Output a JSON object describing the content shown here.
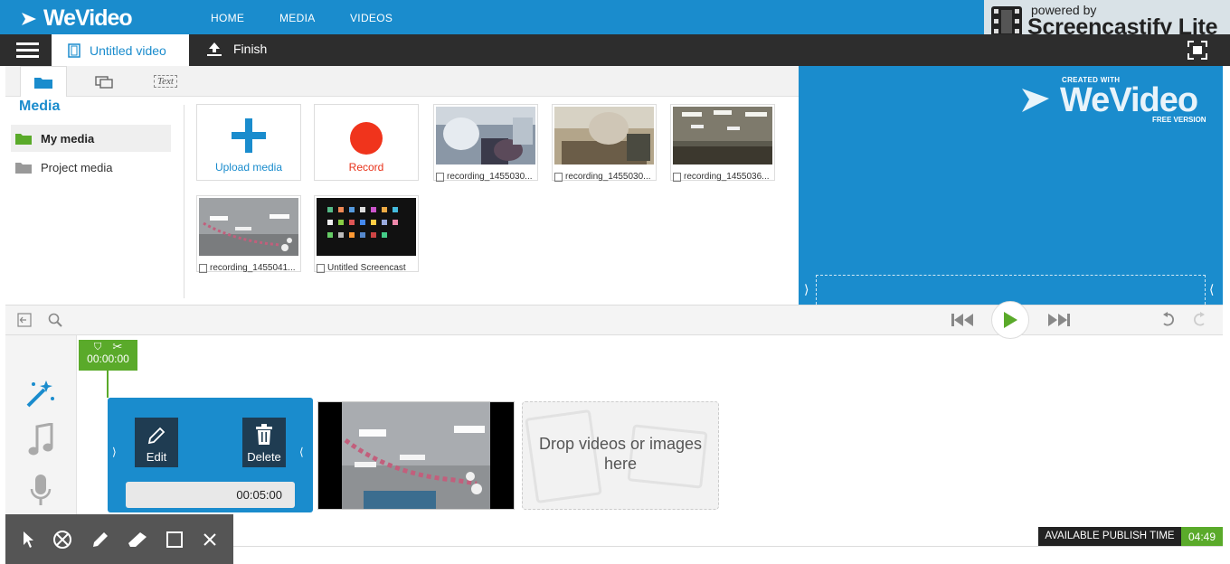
{
  "brand": {
    "logo_text": "WeVideo"
  },
  "nav": {
    "home": "HOME",
    "media": "MEDIA",
    "videos": "VIDEOS"
  },
  "screencastify": {
    "powered_by": "powered by",
    "name": "Screencastify Lite"
  },
  "project": {
    "title": "Untitled video",
    "finish_label": "Finish"
  },
  "media_panel": {
    "tab_text_label": "Text",
    "heading": "Media",
    "sidebar": [
      {
        "label": "My media",
        "selected": true
      },
      {
        "label": "Project media",
        "selected": false
      }
    ],
    "upload_label": "Upload media",
    "record_label": "Record",
    "items": [
      {
        "caption": "recording_1455030..."
      },
      {
        "caption": "recording_1455030..."
      },
      {
        "caption": "recording_1455036..."
      },
      {
        "caption": "recording_1455041..."
      },
      {
        "caption": "Untitled Screencast"
      }
    ]
  },
  "preview": {
    "created_with": "CREATED WITH",
    "logo": "WeVideo",
    "free_version": "FREE VERSION"
  },
  "timeline": {
    "playhead_time": "00:00:00",
    "clip1": {
      "edit_label": "Edit",
      "delete_label": "Delete",
      "duration": "00:05:00"
    },
    "drop_zone_text": "Drop videos or images here",
    "publish_label": "AVAILABLE PUBLISH TIME",
    "publish_time": "04:49"
  },
  "colors": {
    "accent": "#1a8ccd",
    "green": "#5aaa2a",
    "record_red": "#f0341c",
    "dark": "#2d2d2d"
  }
}
